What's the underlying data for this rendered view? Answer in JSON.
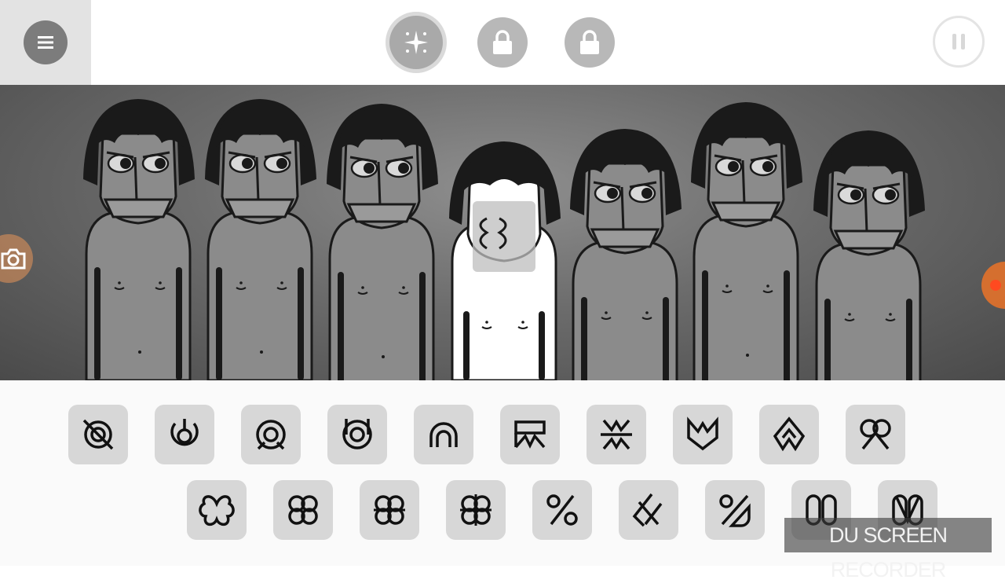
{
  "top_bar": {
    "menu_icon": "hamburger-menu-icon",
    "effects_icon": "sparkle-icon",
    "bonus_lock_icons": [
      "lock-icon",
      "lock-icon"
    ],
    "pause_icon": "pause-icon"
  },
  "stage": {
    "background": "#6c6c6c",
    "characters": [
      {
        "state": "active",
        "color": "gray"
      },
      {
        "state": "active",
        "color": "gray"
      },
      {
        "state": "active",
        "color": "gray"
      },
      {
        "state": "empty",
        "color": "white"
      },
      {
        "state": "active",
        "color": "gray"
      },
      {
        "state": "active",
        "color": "gray"
      },
      {
        "state": "active",
        "color": "gray"
      }
    ],
    "camera_icon": "camera-icon",
    "record_icon": "record-icon"
  },
  "sound_palette": {
    "row1": [
      "beat-sound-1-icon",
      "beat-sound-2-icon",
      "beat-sound-3-icon",
      "beat-sound-4-icon",
      "beat-sound-5-icon",
      "effect-sound-1-icon",
      "effect-sound-2-icon",
      "effect-sound-3-icon",
      "effect-sound-4-icon",
      "effect-sound-5-icon"
    ],
    "row2": [
      "melody-sound-1-icon",
      "melody-sound-2-icon",
      "melody-sound-3-icon",
      "melody-sound-4-icon",
      "voice-sound-1-icon",
      "voice-sound-2-icon",
      "voice-sound-3-icon",
      "voice-sound-4-icon",
      "voice-sound-5-icon"
    ]
  },
  "watermark": {
    "text": "DU SCREEN RECORDER"
  }
}
